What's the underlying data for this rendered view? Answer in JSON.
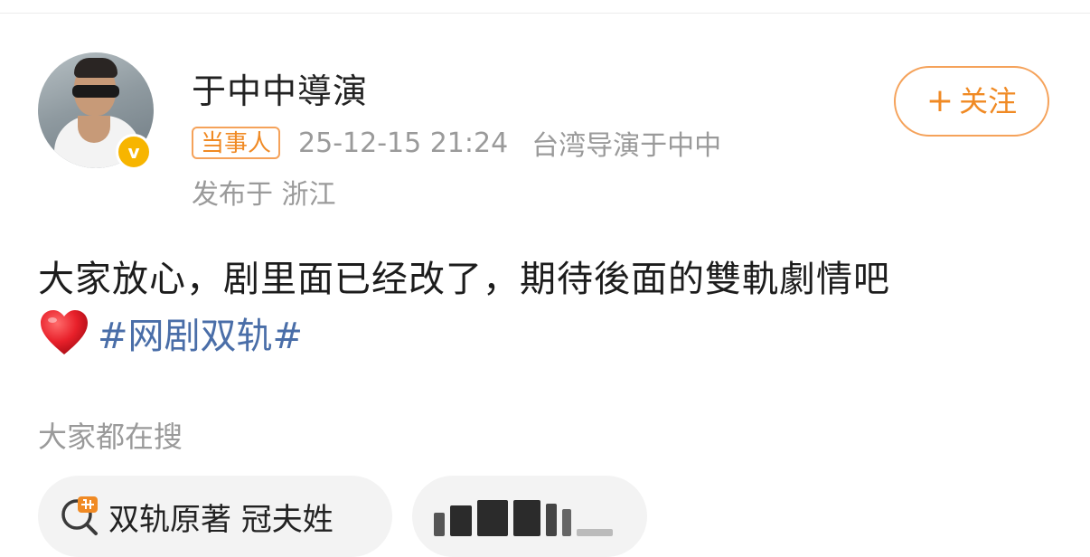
{
  "post": {
    "author": {
      "name": "于中中導演",
      "avatar_desc": "avatar",
      "verified": true
    },
    "follow_button": {
      "plus": "+",
      "label": "关注"
    },
    "meta": {
      "role_badge": "当事人",
      "timestamp": "25-12-15 21:24",
      "source": "台湾导演于中中",
      "location": "发布于 浙江"
    },
    "content": {
      "line1": "大家放心，剧里面已经改了，期待後面的雙軌劇情吧",
      "emoji": "red-heart-icon",
      "hashtag": "#网剧双轨#"
    }
  },
  "trending": {
    "title": "大家都在搜",
    "items": [
      {
        "icon": "hot-search-icon",
        "text": "双轨原著 冠夫姓"
      },
      {
        "icon": "",
        "text": ""
      }
    ]
  },
  "colors": {
    "accent_orange": "#f08a24",
    "hashtag_blue": "#4a6ea8",
    "meta_gray": "#9a9a9a",
    "verified_gold": "#f7b500"
  }
}
